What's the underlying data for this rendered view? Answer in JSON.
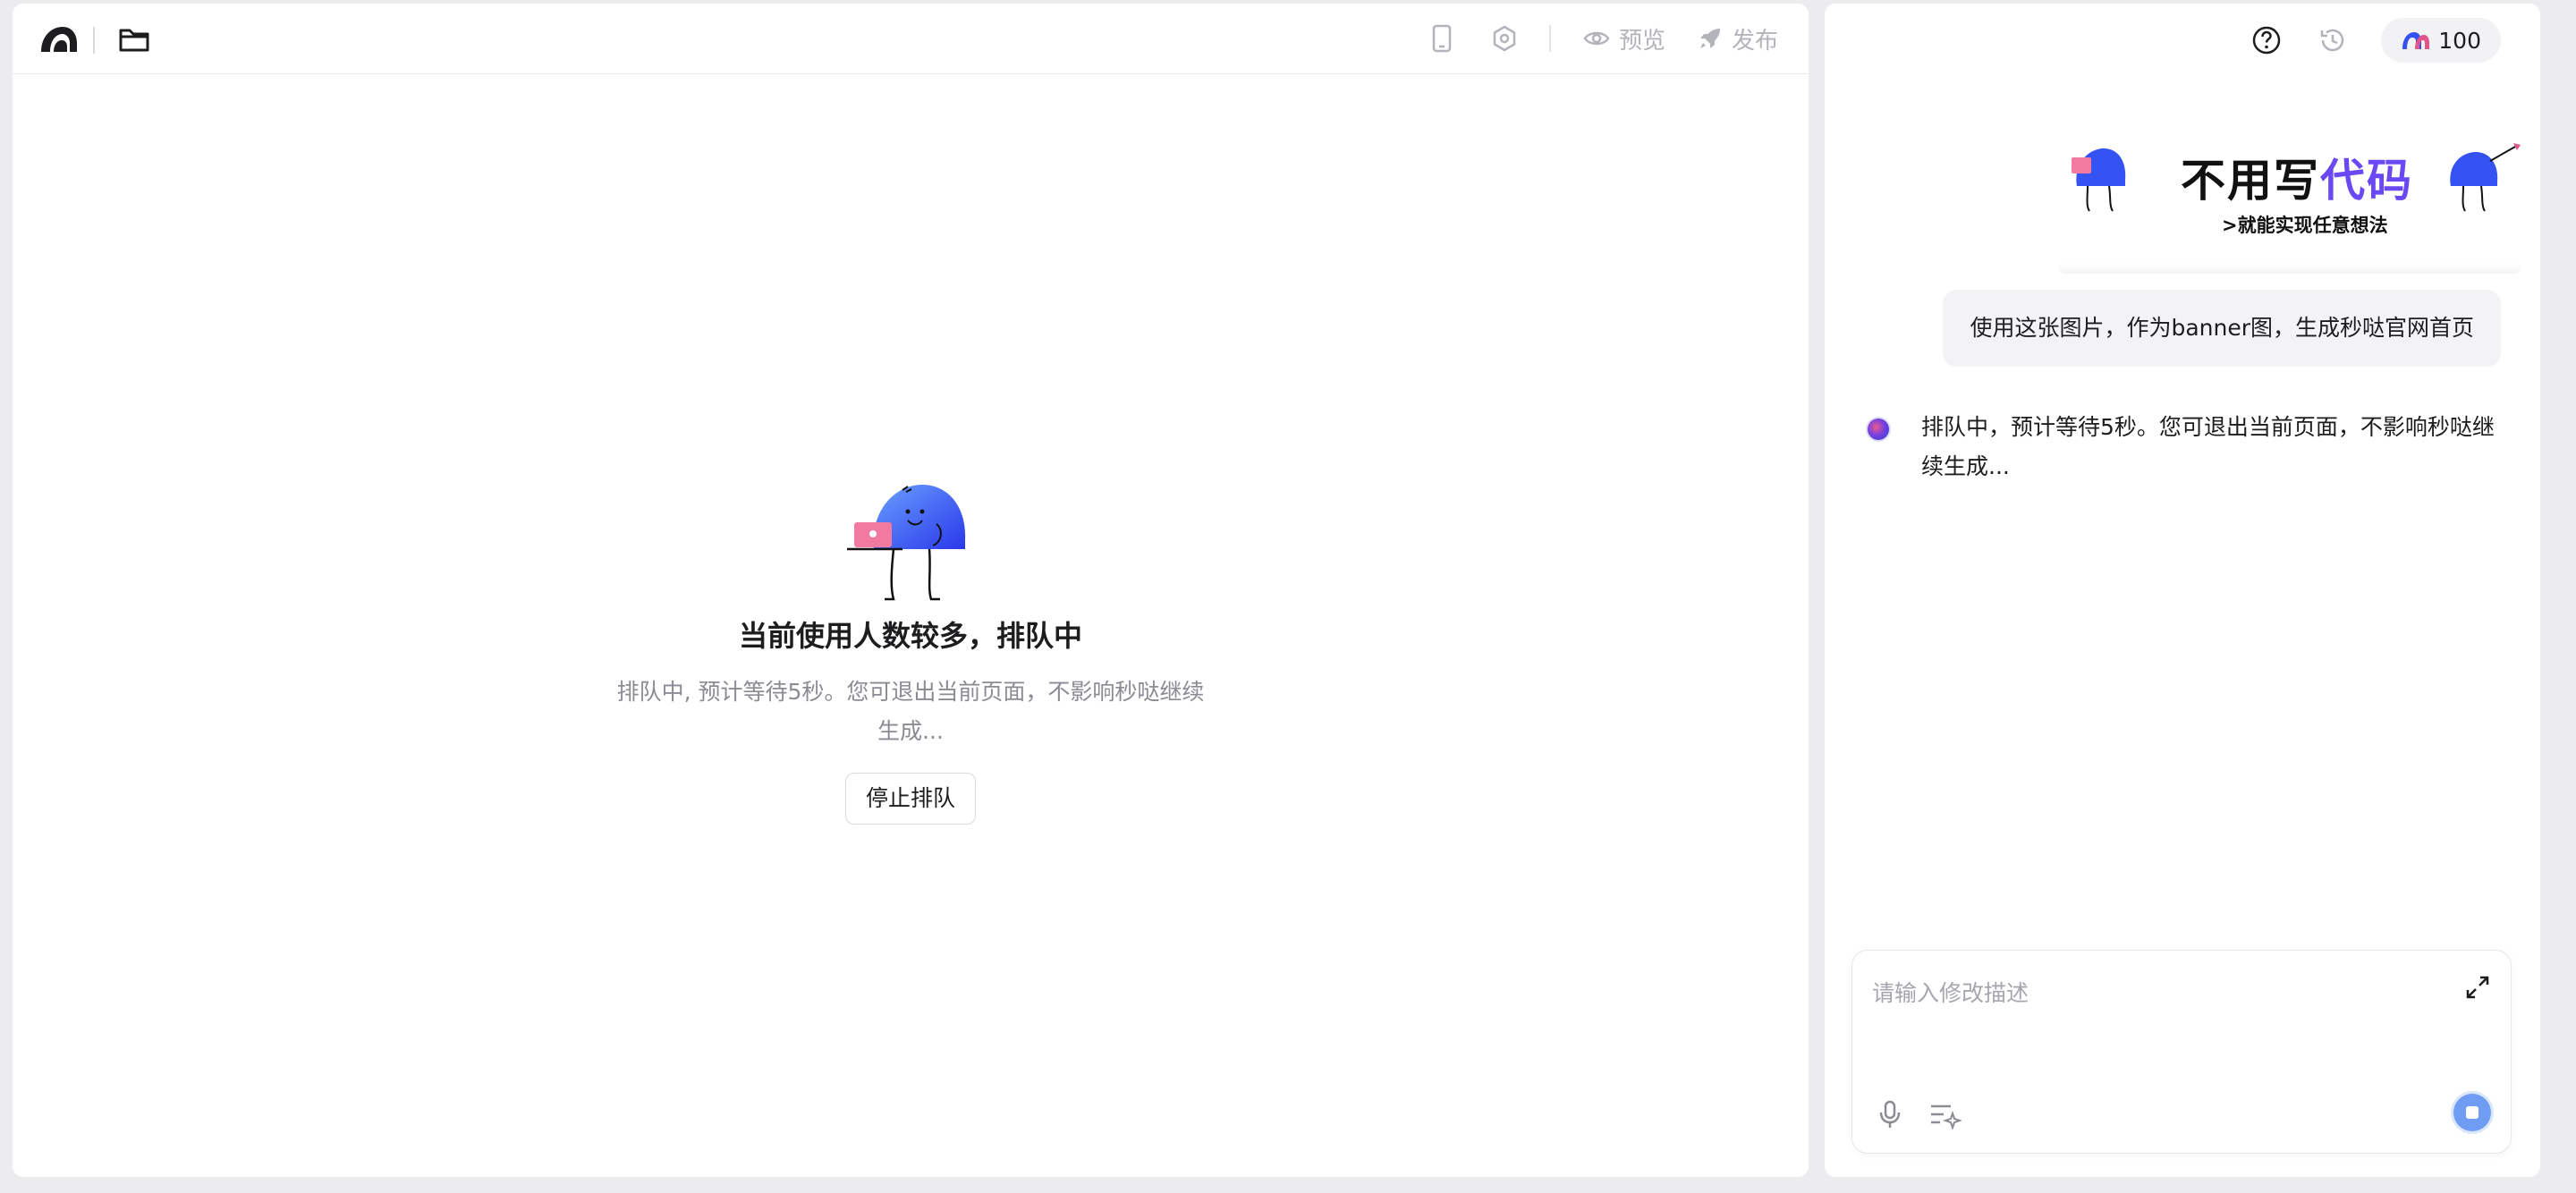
{
  "toolbar": {
    "preview_label": "预览",
    "publish_label": "发布"
  },
  "queue": {
    "title": "当前使用人数较多，排队中",
    "description": "排队中, 预计等待5秒。您可退出当前页面，不影响秒哒继续生成...",
    "stop_button": "停止排队"
  },
  "header": {
    "credits": "100"
  },
  "banner": {
    "title_part1": "不用写",
    "title_part2": "代码",
    "subtitle": ">就能实现任意想法"
  },
  "chat": {
    "user_message": "使用这张图片，作为banner图，生成秒哒官网首页",
    "ai_message": "排队中，预计等待5秒。您可退出当前页面，不影响秒哒继续生成..."
  },
  "input": {
    "placeholder": "请输入修改描述"
  },
  "colors": {
    "accent": "#6a48f4",
    "send_button": "#6f9df3",
    "mascot_blue": "#3552f2"
  },
  "icons": [
    "logo-icon",
    "folder-icon",
    "mobile-icon",
    "settings-icon",
    "eye-icon",
    "rocket-icon",
    "help-icon",
    "history-icon",
    "credits-icon",
    "expand-icon",
    "mic-icon",
    "prompt-icon",
    "stop-icon"
  ]
}
